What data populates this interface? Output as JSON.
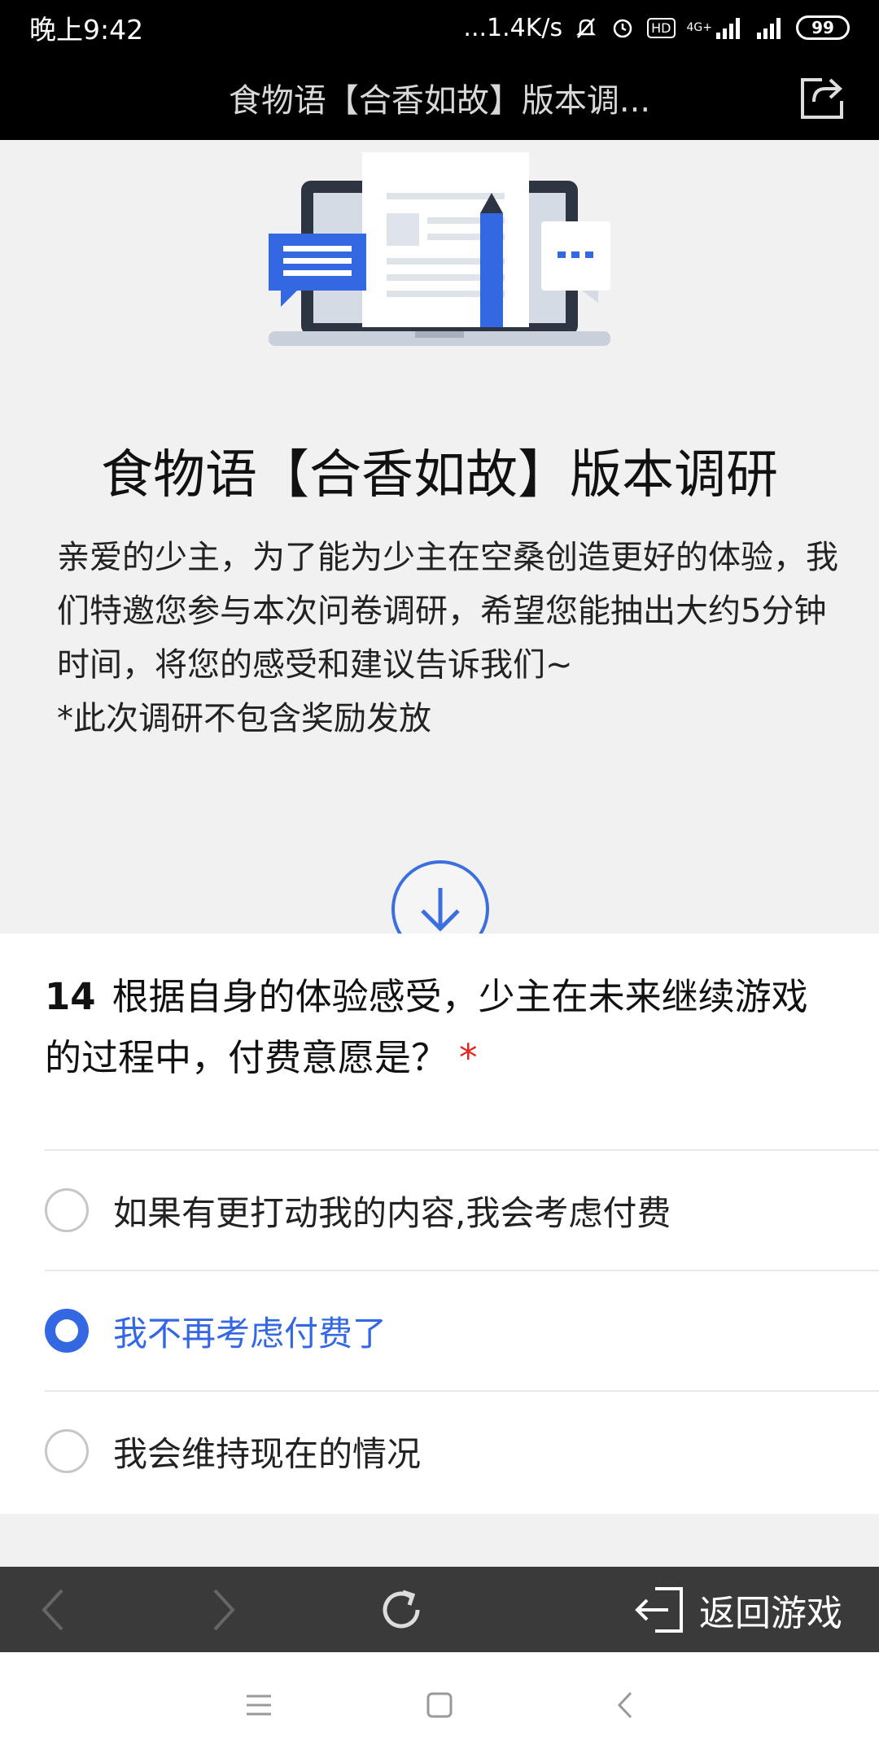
{
  "status_bar": {
    "time": "晚上9:42",
    "network_speed": "...1.4K/s",
    "hd_badge": "HD",
    "network_type": "4G+",
    "battery": "99"
  },
  "title_bar": {
    "title": "食物语【合香如故】版本调..."
  },
  "header": {
    "survey_title": "食物语【合香如故】版本调研",
    "intro_text": "亲爱的少主，为了能为少主在空桑创造更好的体验，我们特邀您参与本次问卷调研，希望您能抽出大约5分钟时间，将您的感受和建议告诉我们~",
    "note_text": "*此次调研不包含奖励发放"
  },
  "question": {
    "number": "14",
    "text": "根据自身的体验感受，少主在未来继续游戏的过程中，付费意愿是？",
    "required_mark": "*",
    "options": [
      {
        "label": "如果有更打动我的内容,我会考虑付费",
        "selected": false
      },
      {
        "label": "我不再考虑付费了",
        "selected": true
      },
      {
        "label": "我会维持现在的情况",
        "selected": false
      }
    ]
  },
  "bottom_bar": {
    "back_to_game": "返回游戏"
  },
  "colors": {
    "accent": "#3468e3",
    "required": "#e0261e"
  }
}
